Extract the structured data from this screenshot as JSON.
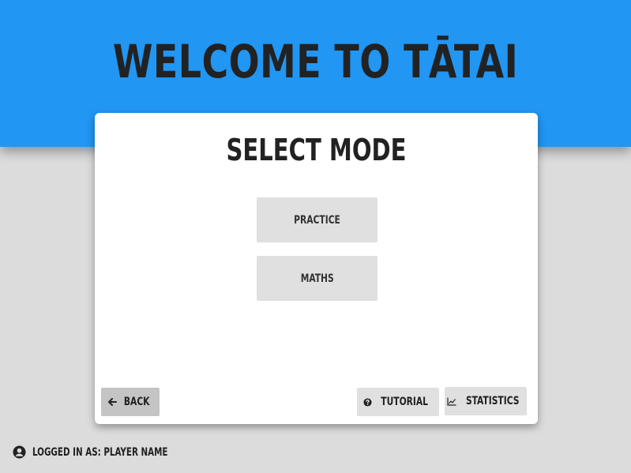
{
  "header": {
    "title": "WELCOME TO TĀTAI",
    "background_color": "#2196f3"
  },
  "card": {
    "title": "SELECT MODE",
    "modes": [
      {
        "label": "PRACTICE"
      },
      {
        "label": "MATHS"
      }
    ]
  },
  "footer": {
    "back_label": "BACK",
    "back_icon": "arrow-left-icon",
    "tutorial_label": "TUTORIAL",
    "tutorial_icon": "question-circle-icon",
    "statistics_label": "STATISTICS",
    "statistics_icon": "line-chart-icon"
  },
  "user": {
    "status_text": "LOGGED IN AS: PLAYER NAME",
    "icon": "user-circle-icon"
  }
}
